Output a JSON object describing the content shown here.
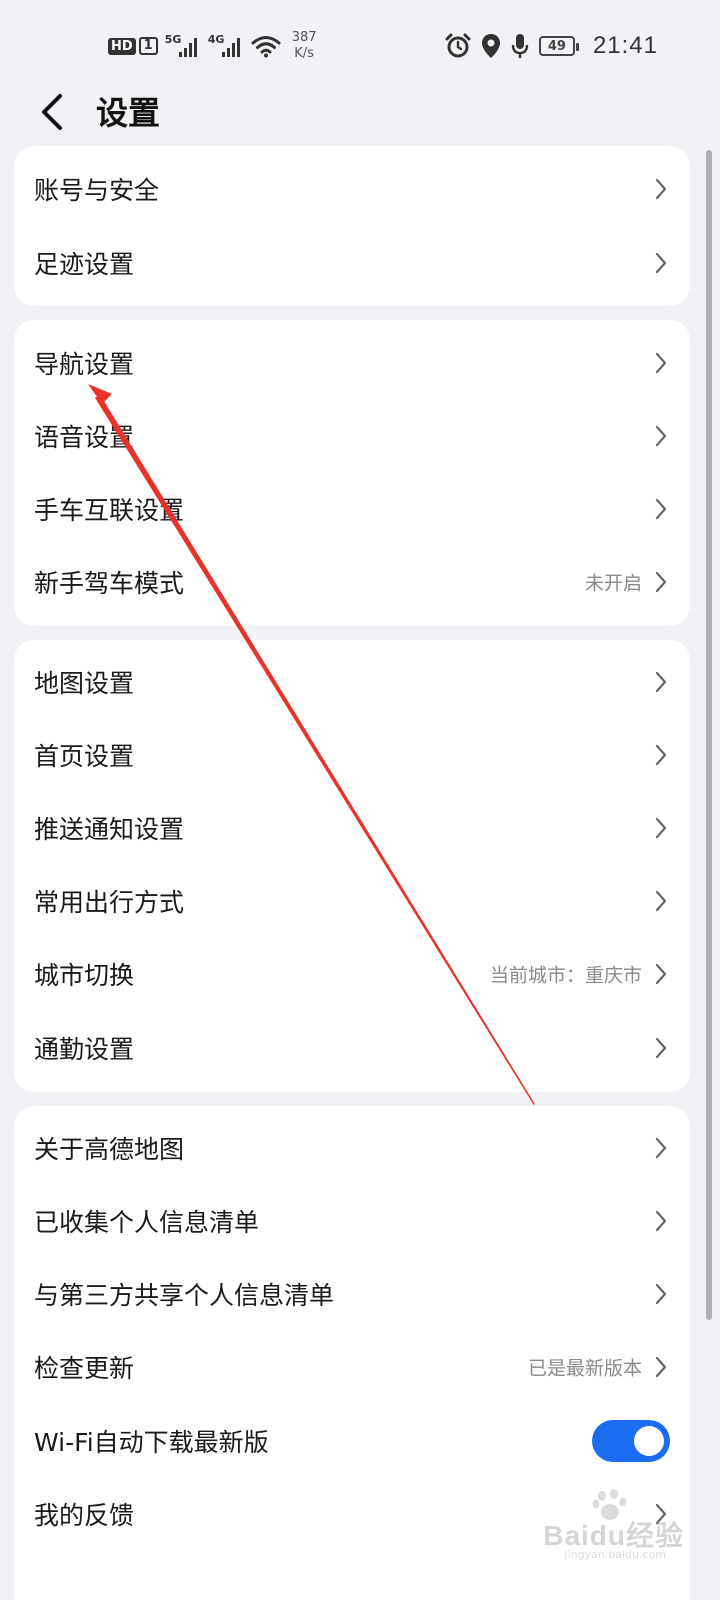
{
  "status_bar": {
    "hd_label": "HD",
    "sim_label": "1",
    "network_5g": "5G",
    "network_4g": "4G",
    "speed_value": "387",
    "speed_unit": "K/s",
    "battery": "49",
    "time": "21:41",
    "icons": [
      "alarm-icon",
      "location-icon",
      "microphone-icon",
      "battery-icon",
      "wifi-icon"
    ]
  },
  "header": {
    "title": "设置"
  },
  "groups": [
    {
      "items": [
        {
          "label": "账号与安全",
          "value": ""
        },
        {
          "label": "足迹设置",
          "value": ""
        }
      ]
    },
    {
      "items": [
        {
          "label": "导航设置",
          "value": ""
        },
        {
          "label": "语音设置",
          "value": ""
        },
        {
          "label": "手车互联设置",
          "value": ""
        },
        {
          "label": "新手驾车模式",
          "value": "未开启"
        }
      ]
    },
    {
      "items": [
        {
          "label": "地图设置",
          "value": ""
        },
        {
          "label": "首页设置",
          "value": ""
        },
        {
          "label": "推送通知设置",
          "value": ""
        },
        {
          "label": "常用出行方式",
          "value": ""
        },
        {
          "label": "城市切换",
          "value": "当前城市：重庆市"
        },
        {
          "label": "通勤设置",
          "value": ""
        }
      ]
    },
    {
      "items": [
        {
          "label": "关于高德地图",
          "value": ""
        },
        {
          "label": "已收集个人信息清单",
          "value": ""
        },
        {
          "label": "与第三方共享个人信息清单",
          "value": ""
        },
        {
          "label": "检查更新",
          "value": "已是最新版本"
        },
        {
          "label": "Wi-Fi自动下载最新版",
          "toggle_on": true
        },
        {
          "label": "我的反馈",
          "value": ""
        }
      ]
    }
  ],
  "colors": {
    "accent": "#1a6cf0",
    "annotation_arrow": "#e8322a",
    "background": "#f1f2f5"
  },
  "watermark": {
    "brand": "Baidu经验",
    "url": "jingyan.baidu.com"
  }
}
